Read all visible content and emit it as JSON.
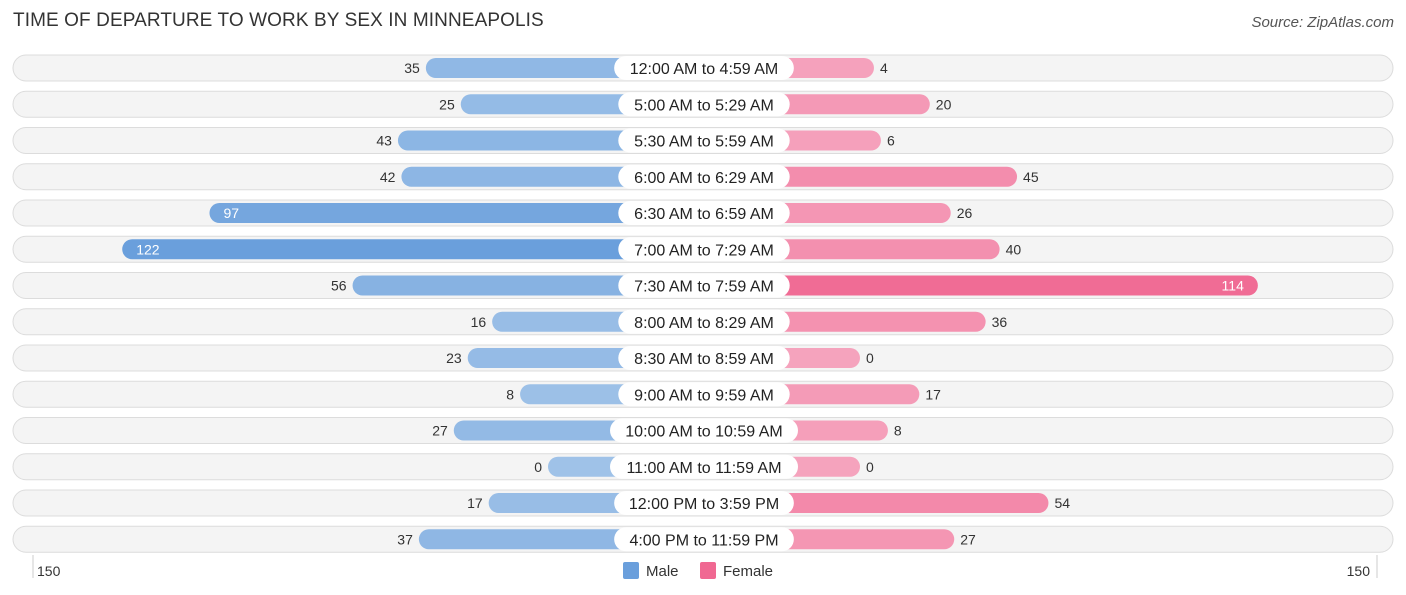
{
  "chart_data": {
    "type": "bar",
    "orientation": "horizontal-diverging",
    "title": "TIME OF DEPARTURE TO WORK BY SEX IN MINNEAPOLIS",
    "source": "Source: ZipAtlas.com",
    "categories": [
      "12:00 AM to 4:59 AM",
      "5:00 AM to 5:29 AM",
      "5:30 AM to 5:59 AM",
      "6:00 AM to 6:29 AM",
      "6:30 AM to 6:59 AM",
      "7:00 AM to 7:29 AM",
      "7:30 AM to 7:59 AM",
      "8:00 AM to 8:29 AM",
      "8:30 AM to 8:59 AM",
      "9:00 AM to 9:59 AM",
      "10:00 AM to 10:59 AM",
      "11:00 AM to 11:59 AM",
      "12:00 PM to 3:59 PM",
      "4:00 PM to 11:59 PM"
    ],
    "series": [
      {
        "name": "Male",
        "color": "#6a9fdc",
        "light_color": "#9fc2e8",
        "values": [
          35,
          25,
          43,
          42,
          97,
          122,
          56,
          16,
          23,
          8,
          27,
          0,
          17,
          37
        ]
      },
      {
        "name": "Female",
        "color": "#f06892",
        "light_color": "#f5a3bd",
        "values": [
          4,
          20,
          6,
          45,
          26,
          40,
          114,
          36,
          0,
          17,
          8,
          0,
          54,
          27
        ]
      }
    ],
    "axis": {
      "left_label": "150",
      "right_label": "150",
      "max": 150
    },
    "legend": {
      "position": "bottom-center",
      "items": [
        "Male",
        "Female"
      ]
    },
    "grid": false
  }
}
